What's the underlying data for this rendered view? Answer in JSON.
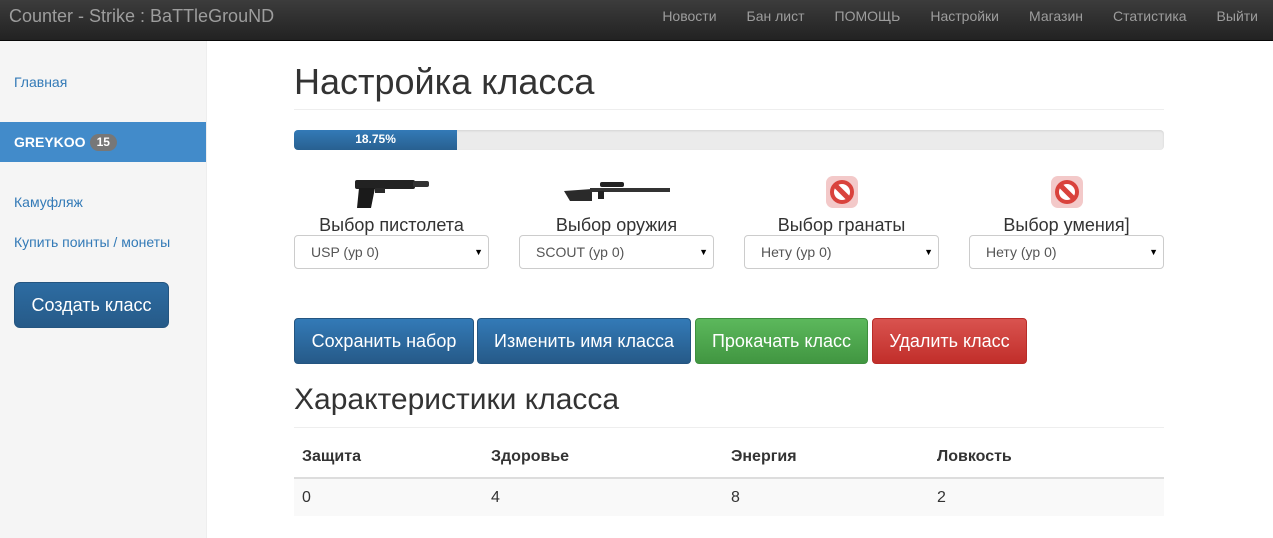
{
  "navbar": {
    "brand": "Counter - Strike : BaTTleGrouND",
    "links": [
      "Новости",
      "Бан лист",
      "ПОМОЩЬ",
      "Настройки",
      "Магазин",
      "Статистика",
      "Выйти"
    ]
  },
  "sidebar": {
    "home": "Главная",
    "user_name": "GREYKOO",
    "user_badge": "15",
    "camo": "Камуфляж",
    "buy": "Купить поинты / монеты",
    "create_button": "Создать класс"
  },
  "page": {
    "title": "Настройка класса",
    "progress": {
      "value": 18.75,
      "label": "18.75%"
    }
  },
  "slots": [
    {
      "label": "Выбор пистолета",
      "value": "USP (ур 0)",
      "icon": "pistol-icon"
    },
    {
      "label": "Выбор оружия",
      "value": "SCOUT (ур 0)",
      "icon": "sniper-rifle-icon"
    },
    {
      "label": "Выбор гранаты",
      "value": "Нету (ур 0)",
      "icon": "forbidden-icon"
    },
    {
      "label": "Выбор умения]",
      "value": "Нету (ур 0)",
      "icon": "forbidden-icon"
    }
  ],
  "actions": {
    "save": "Сохранить набор",
    "rename": "Изменить имя класса",
    "upgrade": "Прокачать класс",
    "delete": "Удалить класс"
  },
  "stats": {
    "heading": "Характеристики класса",
    "columns": [
      "Защита",
      "Здоровье",
      "Энергия",
      "Ловкость"
    ],
    "values": [
      "0",
      "4",
      "8",
      "2"
    ]
  },
  "colors": {
    "primary": "#337ab7",
    "success": "#5cb85c",
    "danger": "#d9534f",
    "sidebar_active": "#428bca"
  }
}
